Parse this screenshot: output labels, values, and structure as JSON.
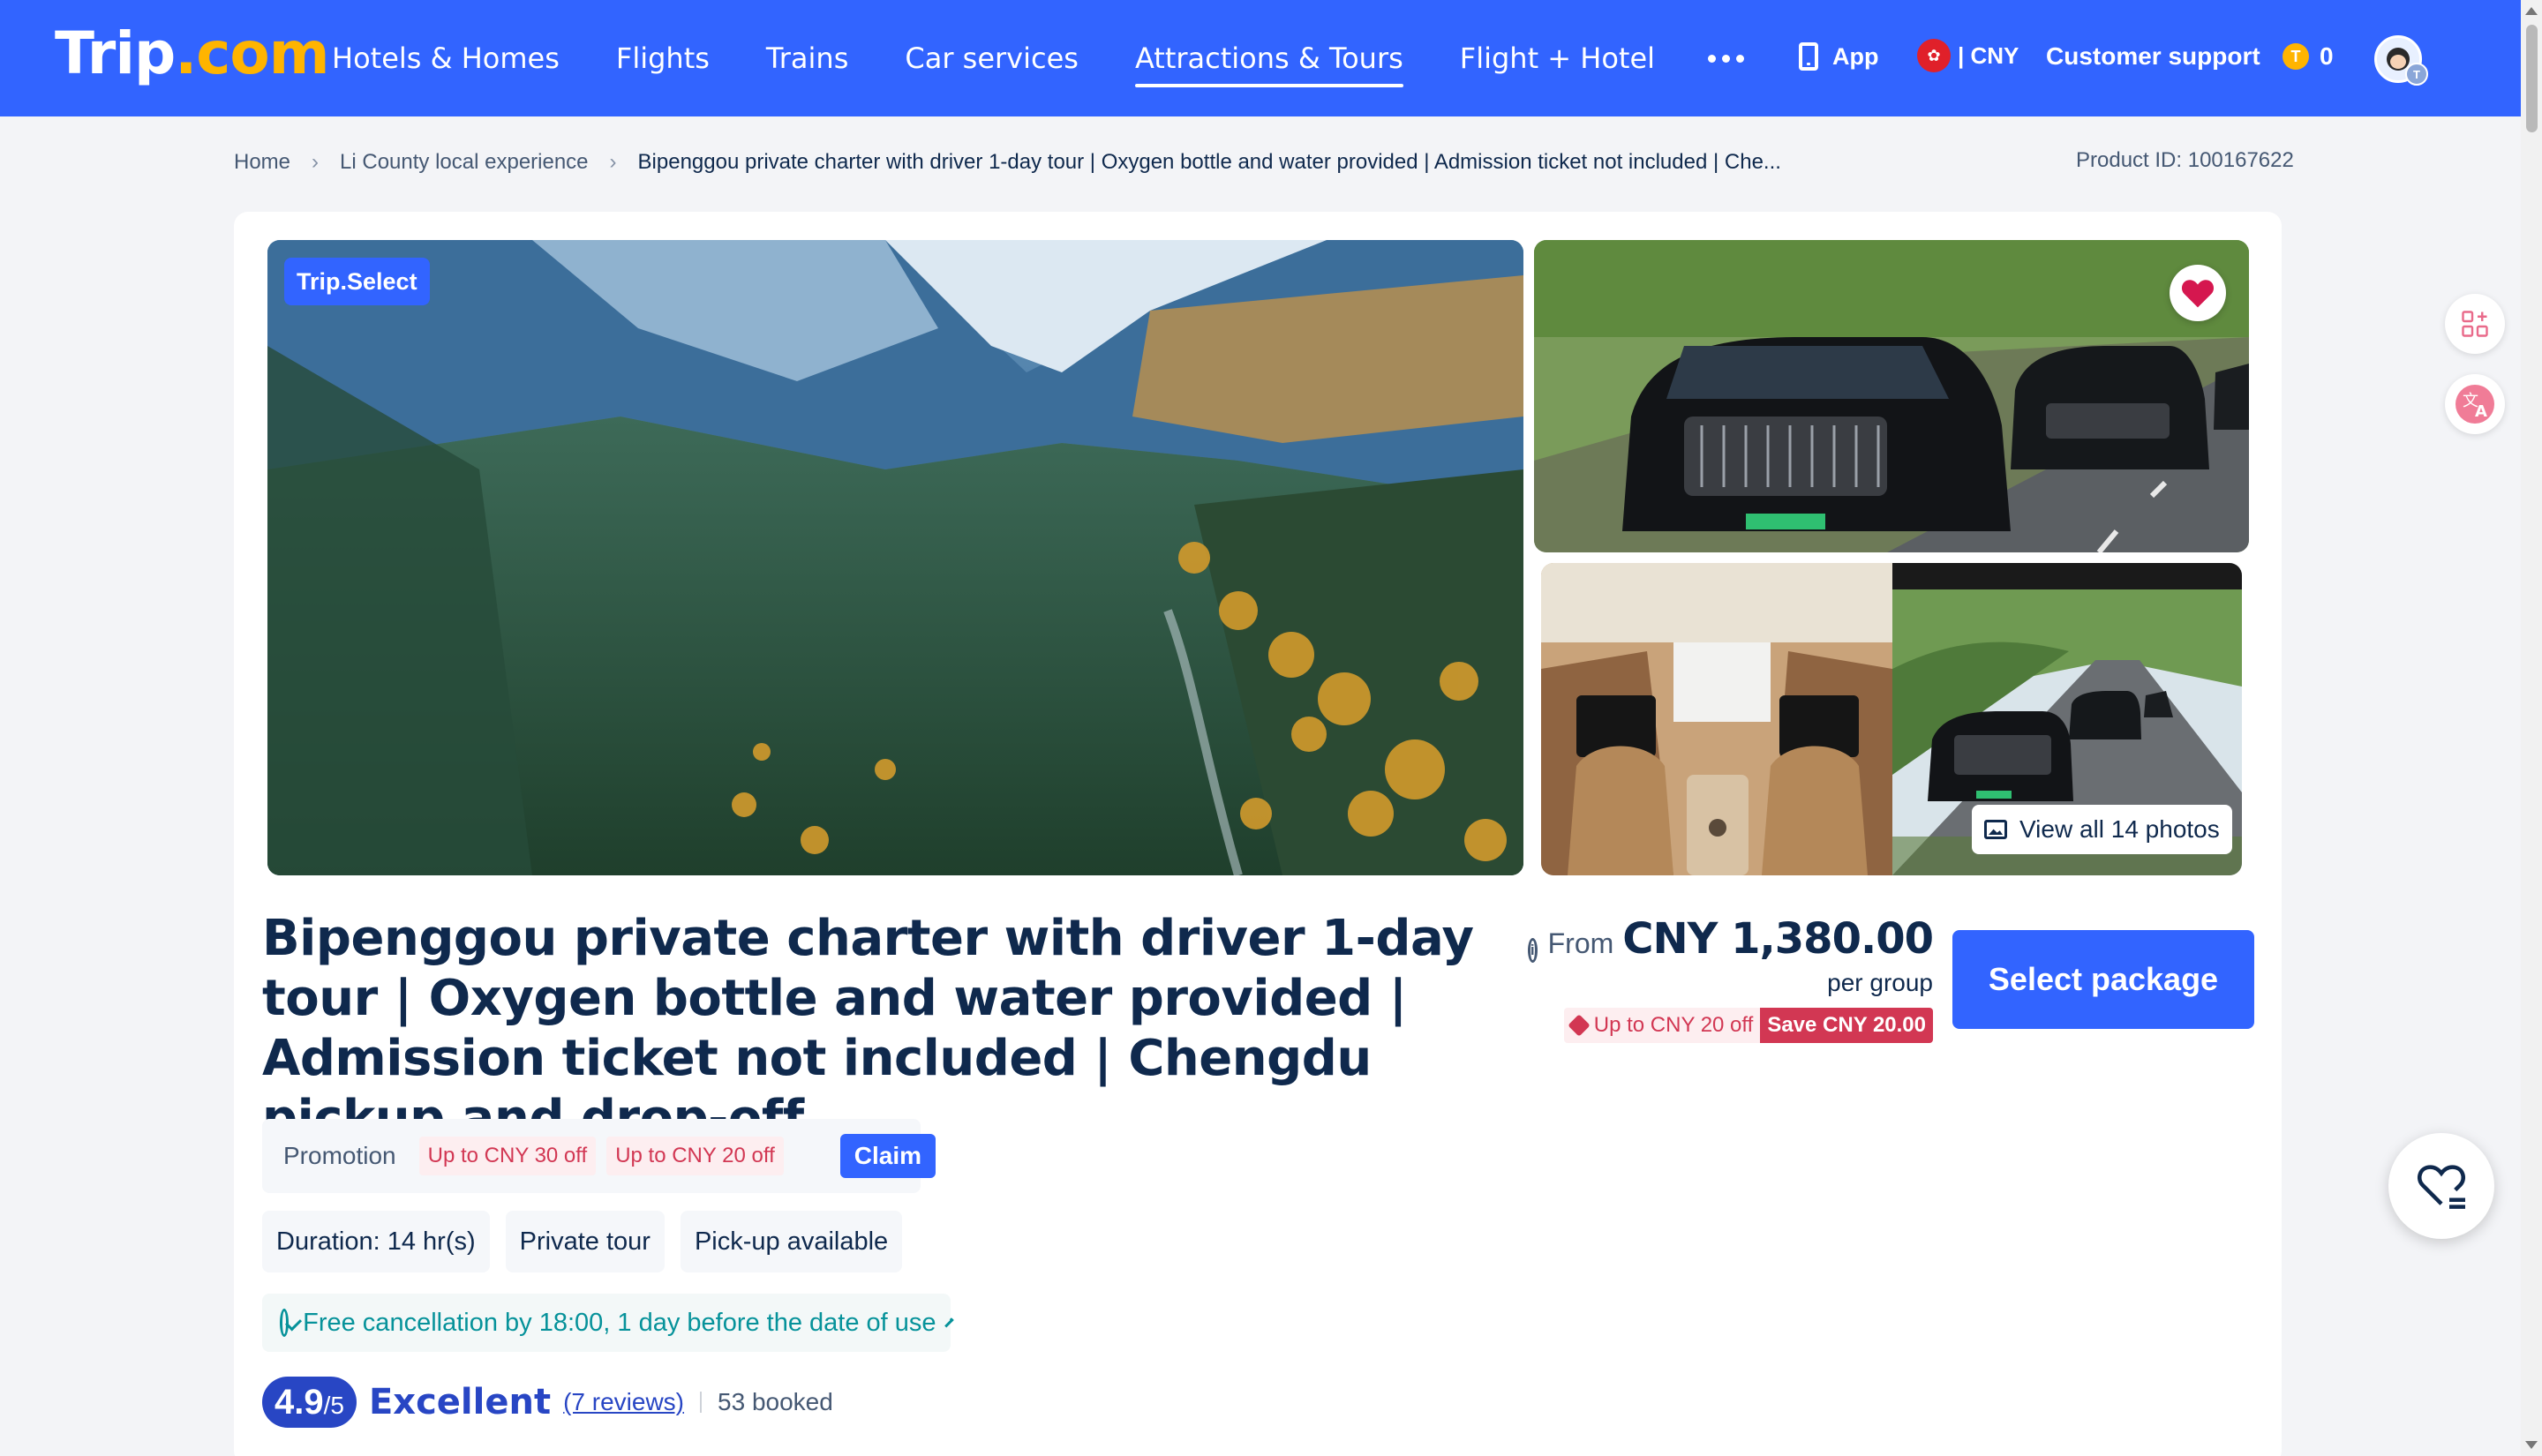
{
  "header": {
    "logo_text": "Trip",
    "logo_suffix": ".com",
    "nav": [
      {
        "label": "Hotels & Homes"
      },
      {
        "label": "Flights"
      },
      {
        "label": "Trains"
      },
      {
        "label": "Car services"
      },
      {
        "label": "Attractions & Tours"
      },
      {
        "label": "Flight + Hotel"
      }
    ],
    "active_nav": "Attractions & Tours",
    "more_icon": "ellipsis-icon",
    "app_label": "App",
    "currency_label": "| CNY",
    "support_label": "Customer support",
    "coins_count": "0"
  },
  "breadcrumb": {
    "items": [
      {
        "label": "Home"
      },
      {
        "label": "Li County local experience"
      },
      {
        "label": "Bipenggou private charter with driver 1-day tour | Oxygen bottle and water provided | Admission ticket not included | Che..."
      }
    ]
  },
  "product_id": "Product ID: 100167622",
  "gallery": {
    "badge": "Trip.Select",
    "view_all": "View all 14 photos"
  },
  "product": {
    "title": "Bipenggou private charter with driver 1-day tour | Oxygen bottle and water provided | Admission ticket not included | Chengdu pickup and drop-off",
    "price_from": "From",
    "price_amount": "CNY 1,380.00",
    "price_unit": "per group",
    "coupon_tag": "Up to CNY 20 off",
    "save_tag": "Save CNY 20.00",
    "select_button": "Select package"
  },
  "promotion": {
    "label": "Promotion",
    "tags": [
      {
        "label": "Up to CNY 30 off"
      },
      {
        "label": "Up to CNY 20 off"
      }
    ],
    "claim_button": "Claim"
  },
  "features": [
    {
      "label": "Duration: 14 hr(s)"
    },
    {
      "label": "Private tour"
    },
    {
      "label": "Pick-up available"
    }
  ],
  "cancellation": "Free cancellation by 18:00, 1 day before the date of use",
  "rating": {
    "score": "4.9",
    "max": "/5",
    "word": "Excellent",
    "reviews": "(7 reviews)",
    "booked": "53 booked"
  },
  "colors": {
    "brand": "#3264ff",
    "navy": "#0f294d",
    "promo_red": "#d23753",
    "teal": "#06929a",
    "rating_blue": "#2846c4"
  }
}
